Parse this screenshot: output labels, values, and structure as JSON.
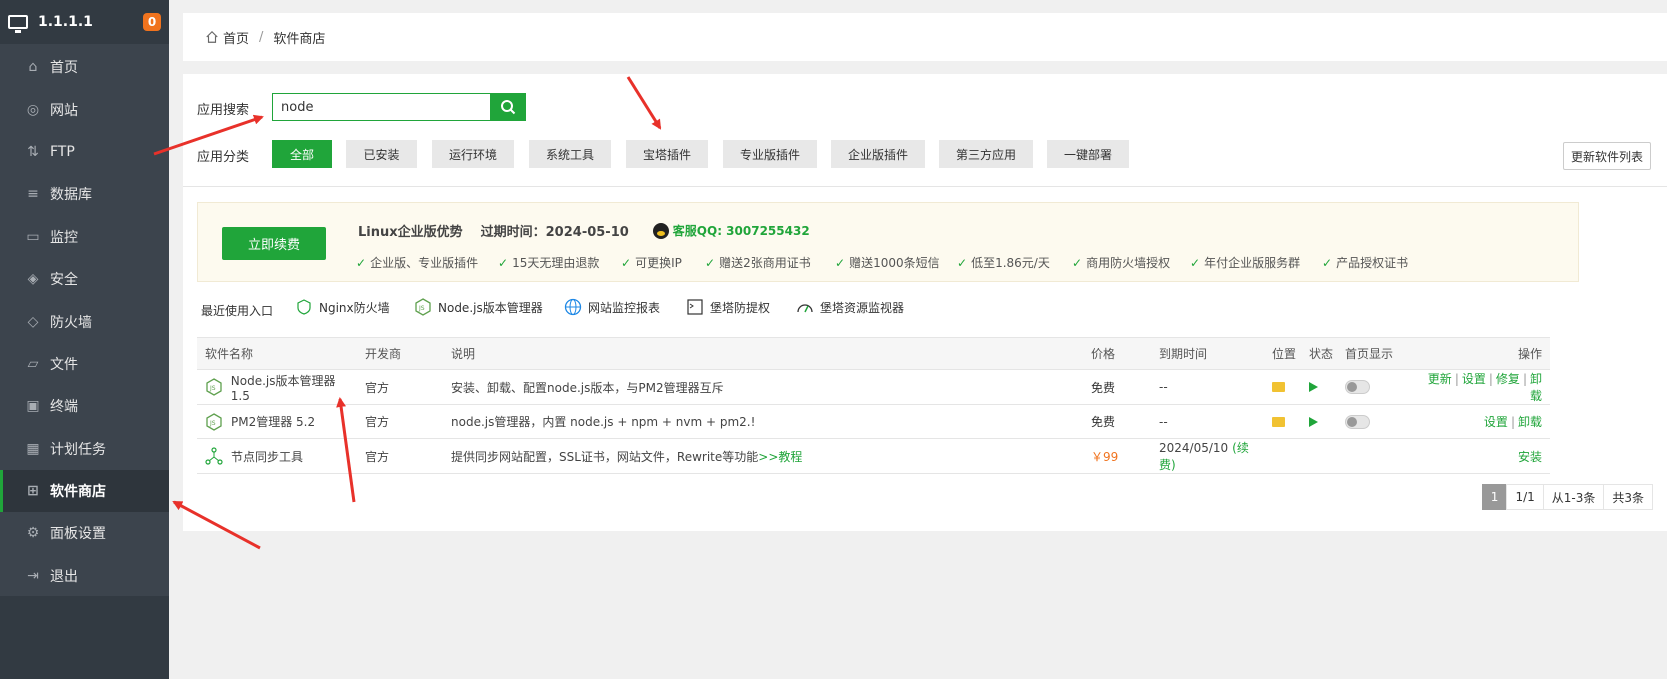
{
  "sidebar": {
    "ip": "1.1.1.1",
    "badge": "0",
    "items": [
      {
        "label": "首页",
        "icon": "home-icon"
      },
      {
        "label": "网站",
        "icon": "globe-icon"
      },
      {
        "label": "FTP",
        "icon": "ftp-icon"
      },
      {
        "label": "数据库",
        "icon": "database-icon"
      },
      {
        "label": "监控",
        "icon": "monitor-icon"
      },
      {
        "label": "安全",
        "icon": "shield-icon"
      },
      {
        "label": "防火墙",
        "icon": "firewall-icon"
      },
      {
        "label": "文件",
        "icon": "folder-icon"
      },
      {
        "label": "终端",
        "icon": "terminal-icon"
      },
      {
        "label": "计划任务",
        "icon": "calendar-icon"
      },
      {
        "label": "软件商店",
        "icon": "grid-icon"
      },
      {
        "label": "面板设置",
        "icon": "gear-icon"
      },
      {
        "label": "退出",
        "icon": "logout-icon"
      }
    ],
    "active": "软件商店"
  },
  "breadcrumb": {
    "home": "首页",
    "sep": "/",
    "current": "软件商店"
  },
  "search": {
    "label": "应用搜索",
    "value": "node"
  },
  "category": {
    "label": "应用分类",
    "items": [
      "全部",
      "已安装",
      "运行环境",
      "系统工具",
      "宝塔插件",
      "专业版插件",
      "企业版插件",
      "第三方应用",
      "一键部署"
    ],
    "active": "全部",
    "update_button": "更新软件列表"
  },
  "promo": {
    "renew_button": "立即续费",
    "title": "Linux企业版优势",
    "expire": "过期时间：2024-05-10",
    "qq": "客服QQ: 3007255432",
    "features": [
      "企业版、专业版插件",
      "15天无理由退款",
      "可更换IP",
      "赠送2张商用证书",
      "赠送1000条短信",
      "低至1.86元/天",
      "商用防火墙授权",
      "年付企业版服务群",
      "产品授权证书"
    ]
  },
  "recent": {
    "label": "最近使用入口",
    "items": [
      "Nginx防火墙",
      "Node.js版本管理器",
      "网站监控报表",
      "堡塔防提权",
      "堡塔资源监视器"
    ]
  },
  "table": {
    "headers": [
      "软件名称",
      "开发商",
      "说明",
      "价格",
      "到期时间",
      "位置",
      "状态",
      "首页显示",
      "操作"
    ],
    "rows": [
      {
        "name": "Node.js版本管理器 1.5",
        "dev": "官方",
        "desc": "安装、卸载、配置node.js版本，与PM2管理器互斥",
        "price": "免费",
        "expire": "--",
        "ops": [
          "更新",
          "设置",
          "修复",
          "卸载"
        ]
      },
      {
        "name": "PM2管理器 5.2",
        "dev": "官方",
        "desc": "node.js管理器，内置 node.js + npm + nvm + pm2.!",
        "price": "免费",
        "expire": "--",
        "ops": [
          "设置",
          "卸载"
        ]
      },
      {
        "name": "节点同步工具",
        "dev": "官方",
        "desc": "提供同步网站配置，SSL证书，网站文件，Rewrite等功能",
        "desc_link": ">>教程",
        "price": "￥99",
        "expire": "2024/05/10",
        "expire_link": "(续费)",
        "ops": [
          "安装"
        ]
      }
    ]
  },
  "pager": {
    "current": "1",
    "pages": "1/1",
    "range": "从1-3条",
    "total": "共3条"
  },
  "colors": {
    "accent": "#20a53a",
    "sidebar": "#3c444d",
    "price": "#f0731e",
    "arrow": "#e8312a"
  }
}
